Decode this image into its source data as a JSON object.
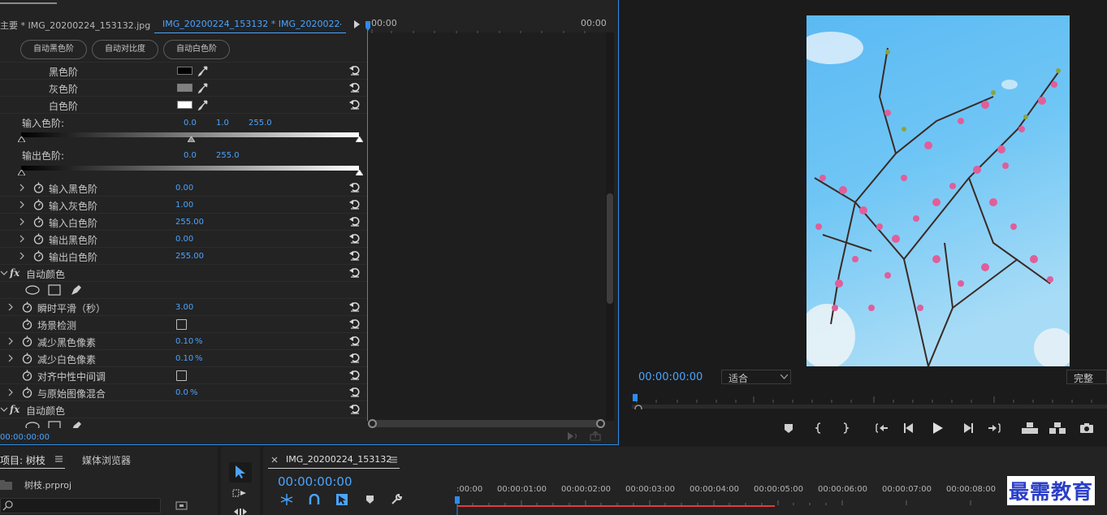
{
  "effect_controls": {
    "tab_master": "主要 * IMG_20200224_153132.jpg",
    "tab_clip": "IMG_20200224_153132 * IMG_20200224_...",
    "timeline_start": "00:00",
    "timeline_end": "00:00",
    "buttons": {
      "auto_black": "自动黑色阶",
      "auto_contrast": "自动对比度",
      "auto_white": "自动白色阶"
    },
    "levels": {
      "black": "黑色阶",
      "gray": "灰色阶",
      "white": "白色阶"
    },
    "input_levels": {
      "label": "输入色阶:",
      "v1": "0.0",
      "v2": "1.0",
      "v3": "255.0"
    },
    "output_levels": {
      "label": "输出色阶:",
      "v1": "0.0",
      "v2": "255.0"
    },
    "params1": [
      {
        "label": "输入黑色阶",
        "value": "0.00"
      },
      {
        "label": "输入灰色阶",
        "value": "1.00"
      },
      {
        "label": "输入白色阶",
        "value": "255.00"
      },
      {
        "label": "输出黑色阶",
        "value": "0.00"
      },
      {
        "label": "输出白色阶",
        "value": "255.00"
      }
    ],
    "fx_label": "fx",
    "auto_color": "自动颜色",
    "params2": {
      "smooth": {
        "label": "瞬时平滑（秒）",
        "value": "3.00"
      },
      "scene": {
        "label": "场景检测"
      },
      "clip_black": {
        "label": "减少黑色像素",
        "value": "0.10",
        "unit": "%"
      },
      "clip_white": {
        "label": "减少白色像素",
        "value": "0.10",
        "unit": "%"
      },
      "snap_neutral": {
        "label": "对齐中性中间调"
      },
      "blend": {
        "label": "与原始图像混合",
        "value": "0.0",
        "unit": "%"
      }
    },
    "auto_color_2": "自动颜色",
    "footer_time": "00:00:00:00"
  },
  "program_monitor": {
    "timecode": "00:00:00:00",
    "fit": "适合",
    "quality": "完整"
  },
  "project_panel": {
    "tab_project": "项目: 树枝",
    "tab_media": "媒体浏览器",
    "file": "树枝.prproj"
  },
  "sequence": {
    "name": "IMG_20200224_153132",
    "timecode": "00:00:00:00",
    "ruler": [
      ":00:00",
      "00:00:01:00",
      "00:00:02:00",
      "00:00:03:00",
      "00:00:04:00",
      "00:00:05:00",
      "00:00:06:00",
      "00:00:07:00",
      "00:00:08:00"
    ]
  },
  "watermark": "最需教育",
  "colors": {
    "accent": "#4ba4ff",
    "playhead": "#2d8ceb",
    "work_area": "#e23b3b"
  }
}
